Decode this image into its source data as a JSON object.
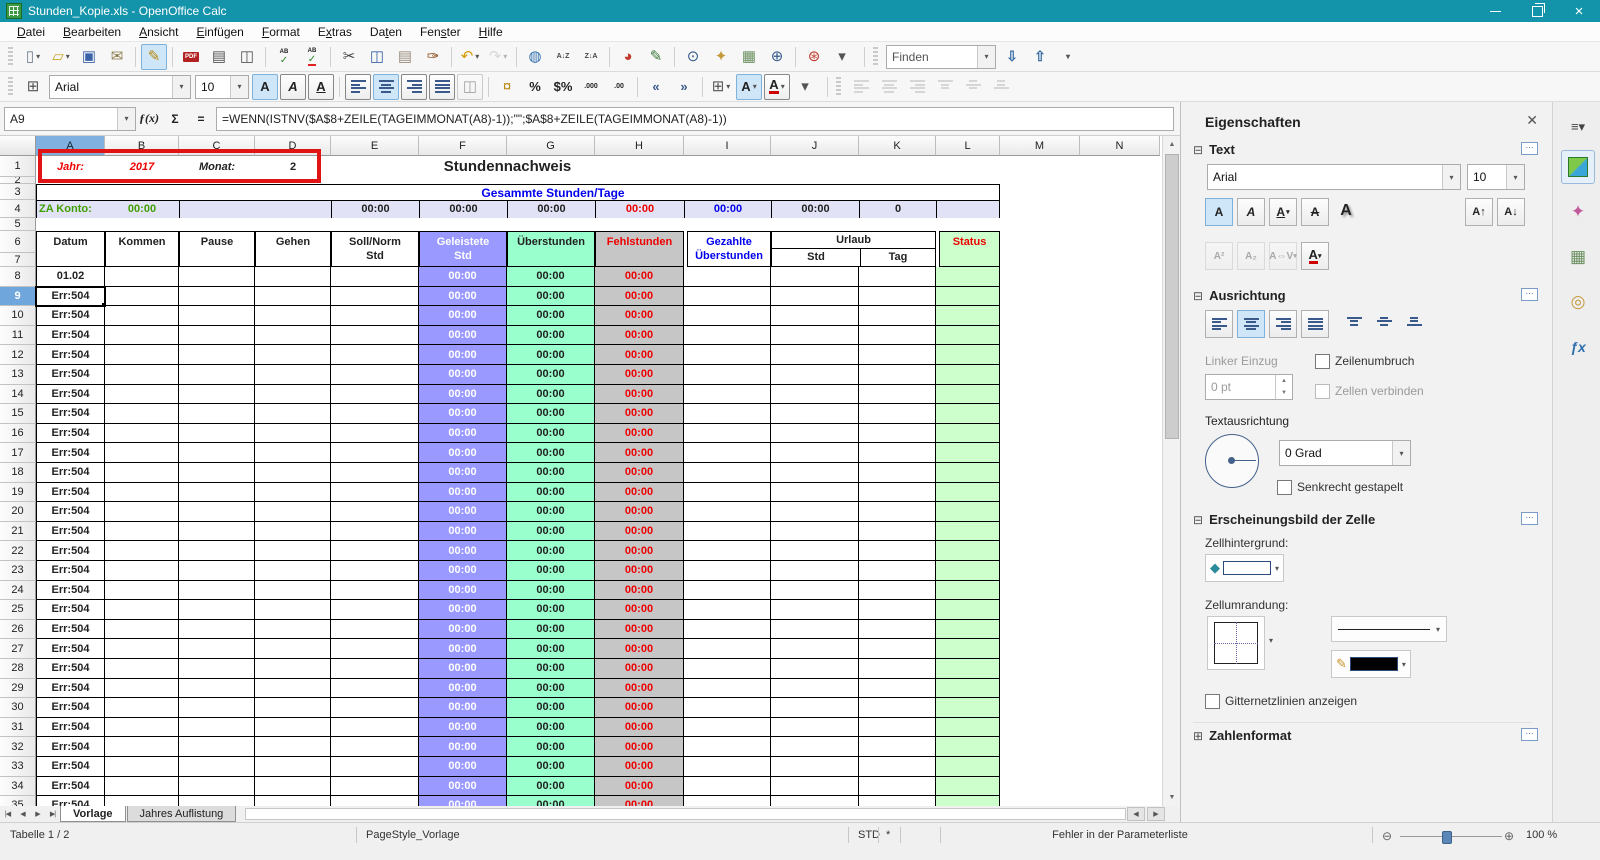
{
  "colors": {
    "titlebar": "#1494ab",
    "purple": "#9999ff",
    "mint": "#99ffcc",
    "grayc": "#c6c6c6",
    "lgreen": "#ccffcc",
    "lav": "#e2e2f6"
  },
  "window": {
    "title": "Stunden_Kopie.xls - OpenOffice Calc",
    "controls": [
      {
        "name": "minimize"
      },
      {
        "name": "restore"
      },
      {
        "name": "close"
      }
    ]
  },
  "menubar": [
    {
      "label": "Datei",
      "hotkey_index": 0
    },
    {
      "label": "Bearbeiten",
      "hotkey_index": 0
    },
    {
      "label": "Ansicht",
      "hotkey_index": 0
    },
    {
      "label": "Einfügen",
      "hotkey_index": 0
    },
    {
      "label": "Format",
      "hotkey_index": 0
    },
    {
      "label": "Extras",
      "hotkey_index": 1
    },
    {
      "label": "Daten",
      "hotkey_index": 2
    },
    {
      "label": "Fenster",
      "hotkey_index": 3
    },
    {
      "label": "Hilfe",
      "hotkey_index": 0
    }
  ],
  "toolbar_standard": [
    {
      "name": "new-document",
      "glyph": "▯",
      "color": "#6b7b8c",
      "dropdown": true
    },
    {
      "name": "open-folder",
      "glyph": "▱",
      "color": "#c9a227",
      "dropdown": true
    },
    {
      "name": "save",
      "glyph": "▣",
      "color": "#3a62a8"
    },
    {
      "name": "email-document",
      "glyph": "✉",
      "color": "#8a7a4a"
    },
    {
      "sep": true
    },
    {
      "name": "edit-mode",
      "glyph": "✎",
      "color": "#b8860b",
      "active": true
    },
    {
      "sep": true
    },
    {
      "name": "export-pdf",
      "badge": "PDF"
    },
    {
      "name": "print",
      "glyph": "▤",
      "color": "#555555"
    },
    {
      "name": "page-preview",
      "glyph": "◫",
      "color": "#555555"
    },
    {
      "sep": true
    },
    {
      "name": "spellcheck",
      "spell": "AB"
    },
    {
      "name": "auto-spellcheck",
      "spell": "AB",
      "underline": true
    },
    {
      "sep": true
    },
    {
      "name": "cut",
      "glyph": "✂",
      "color": "#444444"
    },
    {
      "name": "copy",
      "glyph": "◫",
      "color": "#3a62a8"
    },
    {
      "name": "paste",
      "glyph": "▤",
      "color": "#9a8c7e"
    },
    {
      "name": "format-paintbrush",
      "glyph": "✑",
      "color": "#8b4513"
    },
    {
      "sep": true
    },
    {
      "name": "undo",
      "glyph": "↶",
      "color": "#d39b00",
      "dropdown": true
    },
    {
      "name": "redo",
      "glyph": "↷",
      "color": "#aaaaaa",
      "dropdown": true,
      "disabled": true
    },
    {
      "sep": true
    },
    {
      "name": "hyperlink",
      "glyph": "◍",
      "color": "#2f6fae"
    },
    {
      "name": "sort-ascending",
      "text": "A↓Z",
      "color": "#444444"
    },
    {
      "name": "sort-descending",
      "text": "Z↓A",
      "color": "#444444"
    },
    {
      "sep": true
    },
    {
      "name": "insert-chart",
      "glyph": "◕",
      "color": "#c0392b"
    },
    {
      "name": "draw-functions",
      "glyph": "✎",
      "color": "#3a7a3a"
    },
    {
      "sep": true
    },
    {
      "name": "find-and-replace",
      "glyph": "⊙",
      "color": "#335b8a"
    },
    {
      "name": "navigator",
      "glyph": "✦",
      "color": "#c49a3a"
    },
    {
      "name": "gallery",
      "glyph": "▦",
      "color": "#6a8f5f"
    },
    {
      "name": "zoom",
      "glyph": "⊕",
      "color": "#335b8a"
    },
    {
      "sep": true
    },
    {
      "name": "help",
      "glyph": "⊛",
      "color": "#c0392b"
    },
    {
      "name": "standard-toolbar-options",
      "glyph": "▾",
      "color": "#555555"
    }
  ],
  "find_toolbar": {
    "value": "Finden",
    "buttons": [
      {
        "name": "find-next",
        "glyph": "⇩"
      },
      {
        "name": "find-previous",
        "glyph": "⇧"
      },
      {
        "name": "find-toolbar-options",
        "glyph": "▾"
      }
    ]
  },
  "formatting_toolbar": {
    "font_name": "Arial",
    "font_size": "10",
    "lead_icon": {
      "name": "cell-styles",
      "glyph": "⊞",
      "color": "#555555"
    },
    "icons": [
      {
        "name": "bold",
        "text": "A",
        "style": "bold",
        "boxed": true,
        "active": true
      },
      {
        "name": "italic",
        "text": "A",
        "style": "italic",
        "boxed": true
      },
      {
        "name": "underline",
        "text": "A",
        "style": "underline",
        "boxed": true
      },
      {
        "sep": true
      },
      {
        "name": "align-left",
        "bars": "left",
        "boxed": true
      },
      {
        "name": "align-center",
        "bars": "center",
        "boxed": true,
        "active": true
      },
      {
        "name": "align-right",
        "bars": "right",
        "boxed": true
      },
      {
        "name": "align-justify",
        "bars": "justify",
        "boxed": true
      },
      {
        "name": "merge-cells",
        "glyph": "◫",
        "boxed": true,
        "disabled": true
      },
      {
        "sep": true
      },
      {
        "name": "currency-format",
        "glyph": "¤",
        "color": "#b8860b"
      },
      {
        "name": "percent-format",
        "text": "%",
        "color": "#222222"
      },
      {
        "name": "standard-format",
        "text": "$%",
        "color": "#222222"
      },
      {
        "name": "add-decimal-place",
        "text": ".000",
        "color": "#222222"
      },
      {
        "name": "delete-decimal-place",
        "text": ".00",
        "color": "#222222"
      },
      {
        "sep": true
      },
      {
        "name": "decrease-indent",
        "text": "«",
        "color": "#3a5a8c"
      },
      {
        "name": "increase-indent",
        "text": "»",
        "color": "#3a5a8c"
      },
      {
        "sep": true
      },
      {
        "name": "borders",
        "glyph": "⊞",
        "color": "#555555",
        "dropdown": true
      },
      {
        "name": "background-color",
        "text": "A",
        "boxed": true,
        "active": true,
        "dropdown": true
      },
      {
        "name": "font-color",
        "text": "A",
        "boxed": true,
        "underbar": "#cc0000",
        "dropdown": true
      },
      {
        "name": "formatting-toolbar-options",
        "glyph": "▾",
        "color": "#555555"
      }
    ],
    "disabled_align_icons": [
      {
        "name": "align-left-block",
        "bars": "left"
      },
      {
        "name": "align-center-horizontal",
        "bars": "center"
      },
      {
        "name": "align-right-block",
        "bars": "right"
      },
      {
        "name": "align-top",
        "bars": "top"
      },
      {
        "name": "align-center-vertical",
        "bars": "middle"
      },
      {
        "name": "align-bottom",
        "bars": "bottom"
      }
    ]
  },
  "formula_bar": {
    "cell_reference": "A9",
    "fx_label": "ƒ(x)",
    "sum_label": "Σ",
    "equals_label": "=",
    "formula": "=WENN(ISTNV($A$8+ZEILE(TAGEIMMONAT(A8)-1));\"\";$A$8+ZEILE(TAGEIMMONAT(A8)-1))"
  },
  "grid": {
    "column_headers": [
      "A",
      "B",
      "C",
      "D",
      "E",
      "F",
      "G",
      "H",
      "I",
      "J",
      "K",
      "L",
      "M",
      "N"
    ],
    "selected_column": "A",
    "selected_row": 9,
    "row_count": 35,
    "cells": {
      "jahr_label": "Jahr:",
      "jahr_value": "2017",
      "monat_label": "Monat:",
      "monat_value": "2",
      "sheet_title": "Stundennachweis",
      "summary_title": "Gesammte Stunden/Tage",
      "za_konto_label": "ZA Konto:",
      "za_konto_value": "00:00",
      "summary_values": {
        "e": "00:00",
        "f": "00:00",
        "g": "00:00",
        "h": "00:00",
        "i": "00:00",
        "j": "00:00",
        "k": "0"
      }
    },
    "table_header": {
      "datum": "Datum",
      "kommen": "Kommen",
      "pause": "Pause",
      "gehen": "Gehen",
      "soll_norm": "Soll/Norm",
      "soll_norm_2": "Std",
      "geleistete": "Geleistete",
      "geleistete_2": "Std",
      "ueberstunden": "Überstunden",
      "fehlstunden": "Fehlstunden",
      "gezahlte": "Gezahlte",
      "gezahlte_2": "Überstunden",
      "urlaub": "Urlaub",
      "urlaub_std": "Std",
      "urlaub_tag": "Tag",
      "status": "Status"
    },
    "data_rows": {
      "first": "01.02",
      "error": "Err:504",
      "count": 28,
      "geleistete_value": "00:00",
      "ueberstunden_value": "00:00",
      "fehlstunden_value": "00:00"
    }
  },
  "sheet_tabs": {
    "nav": [
      {
        "name": "first-sheet",
        "glyph": "|◀"
      },
      {
        "name": "previous-sheet",
        "glyph": "◀"
      },
      {
        "name": "next-sheet",
        "glyph": "▶"
      },
      {
        "name": "last-sheet",
        "glyph": "▶|"
      }
    ],
    "tabs": [
      {
        "label": "Vorlage",
        "active": true
      },
      {
        "label": "Jahres Auflistung",
        "active": false
      }
    ]
  },
  "status_bar": {
    "sheet_info": "Tabelle 1 / 2",
    "page_style": "PageStyle_Vorlage",
    "selection_mode": "STD",
    "modified_flag": "*",
    "message": "Fehler in der Parameterliste",
    "zoom_level": "100 %"
  },
  "sidebar": {
    "title": "Eigenschaften",
    "text_section": {
      "title": "Text",
      "font_name": "Arial",
      "font_size": "10",
      "buttons": [
        {
          "name": "bold",
          "text": "A",
          "style": "bold",
          "active": true
        },
        {
          "name": "italic",
          "text": "A",
          "style": "italic"
        },
        {
          "name": "underline",
          "text": "A",
          "style": "underline",
          "dropdown": true
        },
        {
          "name": "strikethrough",
          "text": "A",
          "style": "strike"
        },
        {
          "name": "shadow",
          "text": "A",
          "style": "shadow"
        }
      ],
      "size_buttons": [
        {
          "name": "increase-font-size",
          "text": "A↑"
        },
        {
          "name": "decrease-font-size",
          "text": "A↓"
        }
      ],
      "row2": [
        {
          "name": "superscript",
          "text": "A²",
          "disabled": true
        },
        {
          "name": "subscript",
          "text": "A₂",
          "disabled": true
        },
        {
          "name": "character-spacing",
          "text": "A⇔V",
          "disabled": true,
          "dropdown": true
        },
        {
          "name": "sidebar-font-color",
          "text": "A",
          "underbar": "#cc0000",
          "dropdown": true
        }
      ]
    },
    "alignment_section": {
      "title": "Ausrichtung",
      "horizontal": [
        {
          "name": "align-left",
          "bars": "left"
        },
        {
          "name": "align-center",
          "bars": "center",
          "active": true
        },
        {
          "name": "align-right",
          "bars": "right"
        },
        {
          "name": "align-justify",
          "bars": "justify"
        }
      ],
      "vertical": [
        {
          "name": "align-top",
          "bars": "top"
        },
        {
          "name": "align-center-vertical",
          "bars": "middle"
        },
        {
          "name": "align-bottom",
          "bars": "bottom"
        }
      ],
      "left_indent_label": "Linker Einzug",
      "left_indent_value": "0 pt",
      "wrap_text_label": "Zeilenumbruch",
      "merge_cells_label": "Zellen verbinden",
      "text_orientation_label": "Textausrichtung",
      "rotation_value": "0 Grad",
      "vertically_stacked_label": "Senkrecht gestapelt"
    },
    "cell_appearance_section": {
      "title": "Erscheinungsbild der Zelle",
      "cell_background_label": "Zellhintergrund:",
      "cell_border_label": "Zellumrandung:",
      "show_gridlines_label": "Gitternetzlinien anzeigen"
    },
    "number_format_section": {
      "title": "Zahlenformat"
    },
    "tab_strip": [
      {
        "name": "sidebar-menu"
      },
      {
        "name": "properties-deck",
        "active": true
      },
      {
        "name": "styles-deck"
      },
      {
        "name": "gallery-deck"
      },
      {
        "name": "navigator-deck"
      },
      {
        "name": "functions-deck"
      }
    ]
  }
}
